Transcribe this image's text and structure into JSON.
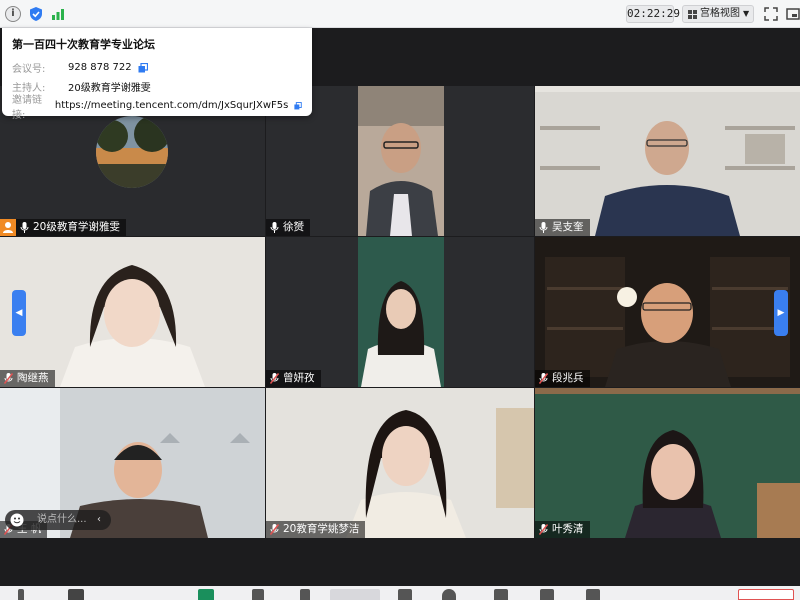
{
  "topbar": {
    "info_icon": "info-icon",
    "shield_icon": "shield-icon",
    "signal_icon": "signal-icon",
    "time": "02:22:29",
    "view_label": "宫格视图",
    "accent": "#2f7bf2"
  },
  "meeting_info": {
    "title": "第一百四十次教育学专业论坛",
    "rows": [
      {
        "key": "会议号:",
        "value": "928 878 722",
        "copyable": true
      },
      {
        "key": "主持人:",
        "value": "20级教育学谢雅雯",
        "copyable": false
      },
      {
        "key": "邀请链接:",
        "value": "https://meeting.tencent.com/dm/JxSqurJXwF5s",
        "copyable": true
      }
    ]
  },
  "participants": [
    {
      "name": "20级教育学谢雅雯",
      "mic": "on",
      "host": true
    },
    {
      "name": "徐赟",
      "mic": "on"
    },
    {
      "name": "吴支奎",
      "mic": "on"
    },
    {
      "name": "陶继燕",
      "mic": "muted"
    },
    {
      "name": "曾妍孜",
      "mic": "muted"
    },
    {
      "name": "段兆兵",
      "mic": "muted"
    },
    {
      "name": "王 帆",
      "mic": "muted"
    },
    {
      "name": "20教育学姚梦洁",
      "mic": "muted"
    },
    {
      "name": "叶秀清",
      "mic": "muted"
    }
  ],
  "chat": {
    "placeholder": "说点什么..."
  },
  "colors": {
    "host_badge": "#f08a24",
    "nav_arrow": "#3a7ff0",
    "muted_mic": "#e05252"
  }
}
